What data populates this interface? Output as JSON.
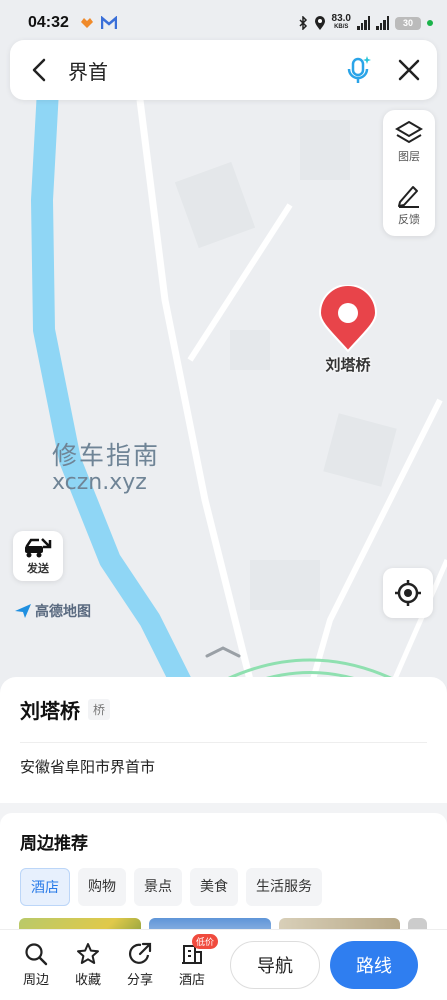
{
  "status_bar": {
    "time": "04:32",
    "net_speed": "83.0",
    "net_unit": "KB/S",
    "battery": "30"
  },
  "search": {
    "query": "界首"
  },
  "tools": {
    "layers_label": "图层",
    "feedback_label": "反馈"
  },
  "map": {
    "pin_label": "刘塔桥",
    "watermark_line1": "修车指南",
    "watermark_line2": "xczn.xyz",
    "send_label": "发送",
    "brand": "高德地图"
  },
  "place": {
    "name": "刘塔桥",
    "tag": "桥",
    "address": "安徽省阜阳市界首市"
  },
  "nearby": {
    "title": "周边推荐",
    "chips": [
      "酒店",
      "购物",
      "景点",
      "美食",
      "生活服务"
    ]
  },
  "bottom_bar": {
    "items": [
      "周边",
      "收藏",
      "分享",
      "酒店"
    ],
    "hotel_badge": "低价",
    "nav_label": "导航",
    "route_label": "路线"
  },
  "colors": {
    "accent": "#2f7ef0",
    "pin": "#e8444a",
    "river": "#8fd6f5"
  }
}
